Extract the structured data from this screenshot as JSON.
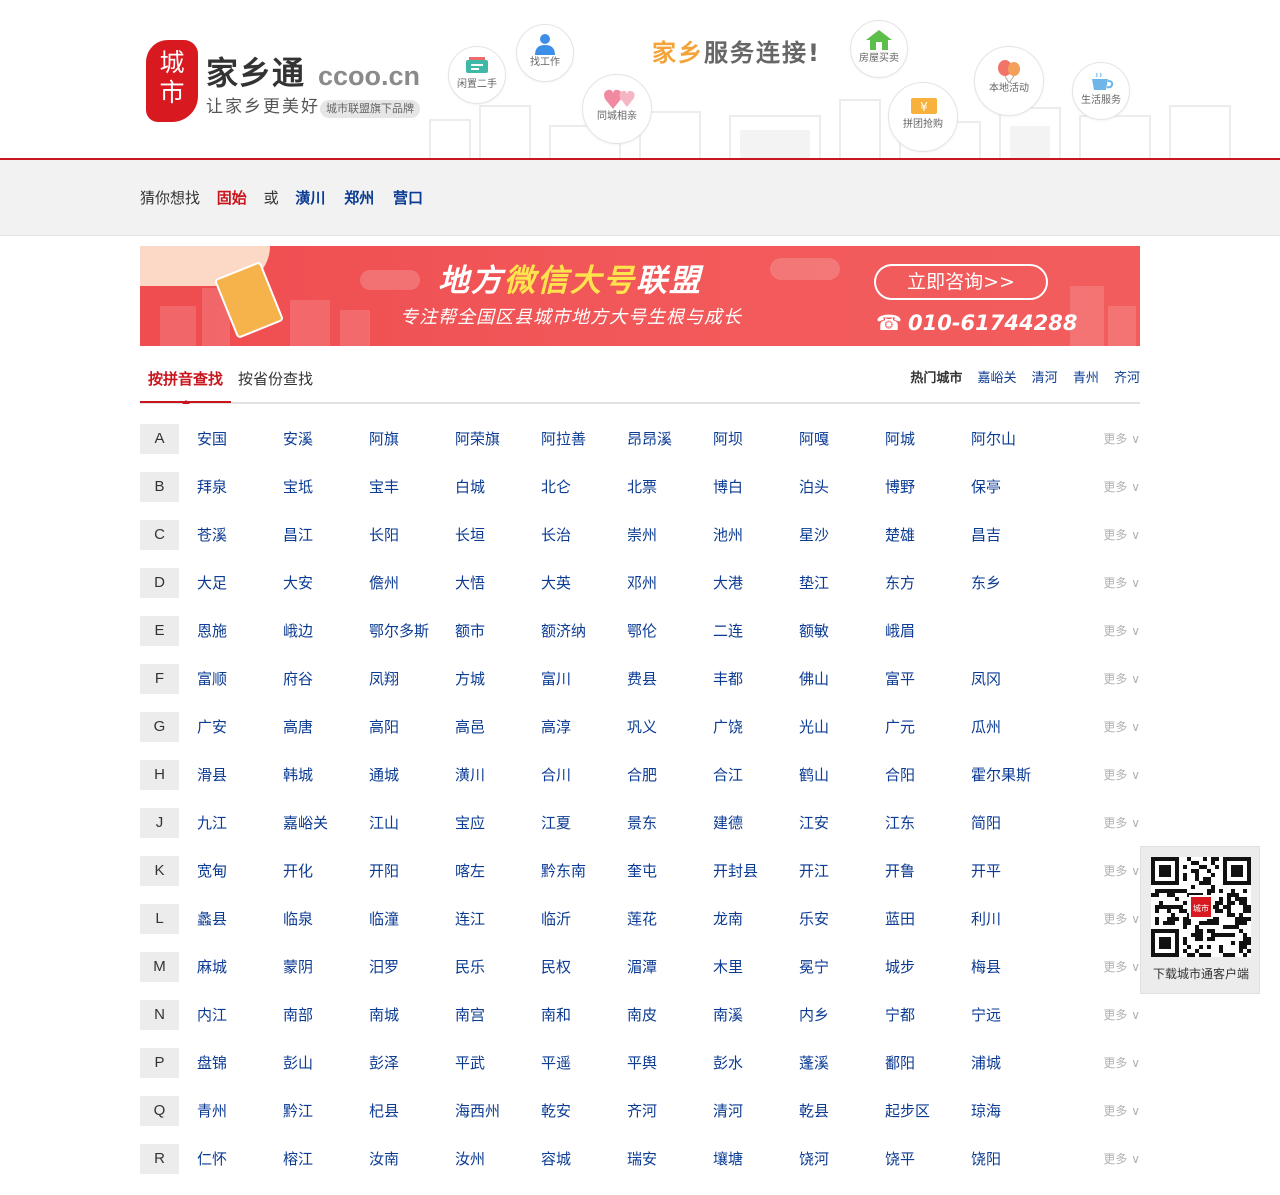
{
  "brand": {
    "seal_line1": "城",
    "seal_line2": "市",
    "name": "家乡通",
    "domain": "ccoo.cn",
    "slogan": "让家乡更美好",
    "badge": "城市联盟旗下品牌"
  },
  "header": {
    "slogan_highlight": "家乡",
    "slogan_rest": "服务连接!",
    "bubbles": [
      {
        "label": "闲置二手",
        "icon": "secondhand-sign-icon"
      },
      {
        "label": "找工作",
        "icon": "person-icon"
      },
      {
        "label": "同城相亲",
        "icon": "hearts-icon"
      },
      {
        "label": "房屋买卖",
        "icon": "house-icon"
      },
      {
        "label": "拼团抢购",
        "icon": "coupon-icon"
      },
      {
        "label": "本地活动",
        "icon": "balloons-icon"
      },
      {
        "label": "生活服务",
        "icon": "coffee-cup-icon"
      }
    ]
  },
  "guess": {
    "prefix": "猜你想找",
    "main": "固始",
    "or": "或",
    "alternatives": [
      "潢川",
      "郑州",
      "营口"
    ]
  },
  "banner": {
    "title_part1": "地方",
    "title_highlight": "微信大号",
    "title_part2": "联盟",
    "subtitle": "专注帮全国区县城市地方大号生根与成长",
    "button": "立即咨询>>",
    "phone_icon": "telephone-icon",
    "phone": "010-61744288"
  },
  "tabs": {
    "pinyin": "按拼音查找",
    "province": "按省份查找",
    "hot_label": "热门城市",
    "hot_cities": [
      "嘉峪关",
      "清河",
      "青州",
      "齐河"
    ]
  },
  "more_label": "更多 ∨",
  "rows": [
    {
      "letter": "A",
      "cities": [
        "安国",
        "安溪",
        "阿旗",
        "阿荣旗",
        "阿拉善",
        "昂昂溪",
        "阿坝",
        "阿嘎",
        "阿城",
        "阿尔山"
      ]
    },
    {
      "letter": "B",
      "cities": [
        "拜泉",
        "宝坻",
        "宝丰",
        "白城",
        "北仑",
        "北票",
        "博白",
        "泊头",
        "博野",
        "保亭"
      ]
    },
    {
      "letter": "C",
      "cities": [
        "苍溪",
        "昌江",
        "长阳",
        "长垣",
        "长治",
        "崇州",
        "池州",
        "星沙",
        "楚雄",
        "昌吉"
      ]
    },
    {
      "letter": "D",
      "cities": [
        "大足",
        "大安",
        "儋州",
        "大悟",
        "大英",
        "邓州",
        "大港",
        "垫江",
        "东方",
        "东乡"
      ]
    },
    {
      "letter": "E",
      "cities": [
        "恩施",
        "峨边",
        "鄂尔多斯",
        "额市",
        "额济纳",
        "鄂伦",
        "二连",
        "额敏",
        "峨眉",
        ""
      ]
    },
    {
      "letter": "F",
      "cities": [
        "富顺",
        "府谷",
        "凤翔",
        "方城",
        "富川",
        "费县",
        "丰都",
        "佛山",
        "富平",
        "凤冈"
      ]
    },
    {
      "letter": "G",
      "cities": [
        "广安",
        "高唐",
        "高阳",
        "高邑",
        "高淳",
        "巩义",
        "广饶",
        "光山",
        "广元",
        "瓜州"
      ]
    },
    {
      "letter": "H",
      "cities": [
        "滑县",
        "韩城",
        "通城",
        "潢川",
        "合川",
        "合肥",
        "合江",
        "鹤山",
        "合阳",
        "霍尔果斯"
      ]
    },
    {
      "letter": "J",
      "cities": [
        "九江",
        "嘉峪关",
        "江山",
        "宝应",
        "江夏",
        "景东",
        "建德",
        "江安",
        "江东",
        "简阳"
      ]
    },
    {
      "letter": "K",
      "cities": [
        "宽甸",
        "开化",
        "开阳",
        "喀左",
        "黔东南",
        "奎屯",
        "开封县",
        "开江",
        "开鲁",
        "开平"
      ]
    },
    {
      "letter": "L",
      "cities": [
        "蠡县",
        "临泉",
        "临潼",
        "连江",
        "临沂",
        "莲花",
        "龙南",
        "乐安",
        "蓝田",
        "利川"
      ]
    },
    {
      "letter": "M",
      "cities": [
        "麻城",
        "蒙阴",
        "汨罗",
        "民乐",
        "民权",
        "湄潭",
        "木里",
        "冕宁",
        "城步",
        "梅县"
      ]
    },
    {
      "letter": "N",
      "cities": [
        "内江",
        "南部",
        "南城",
        "南宫",
        "南和",
        "南皮",
        "南溪",
        "内乡",
        "宁都",
        "宁远"
      ]
    },
    {
      "letter": "P",
      "cities": [
        "盘锦",
        "彭山",
        "彭泽",
        "平武",
        "平遥",
        "平舆",
        "彭水",
        "蓬溪",
        "鄱阳",
        "浦城"
      ]
    },
    {
      "letter": "Q",
      "cities": [
        "青州",
        "黔江",
        "杞县",
        "海西州",
        "乾安",
        "齐河",
        "清河",
        "乾县",
        "起步区",
        "琼海"
      ]
    },
    {
      "letter": "R",
      "cities": [
        "仁怀",
        "榕江",
        "汝南",
        "汝州",
        "容城",
        "瑞安",
        "壤塘",
        "饶河",
        "饶平",
        "饶阳"
      ]
    }
  ],
  "qr": {
    "label": "下载城市通客户端",
    "center_mark": "城市"
  },
  "colors": {
    "brand_red": "#c9151e",
    "city_link": "#0b3b93",
    "banner_bg": "#f25a5b",
    "banner_yellow": "#ffe34d"
  }
}
